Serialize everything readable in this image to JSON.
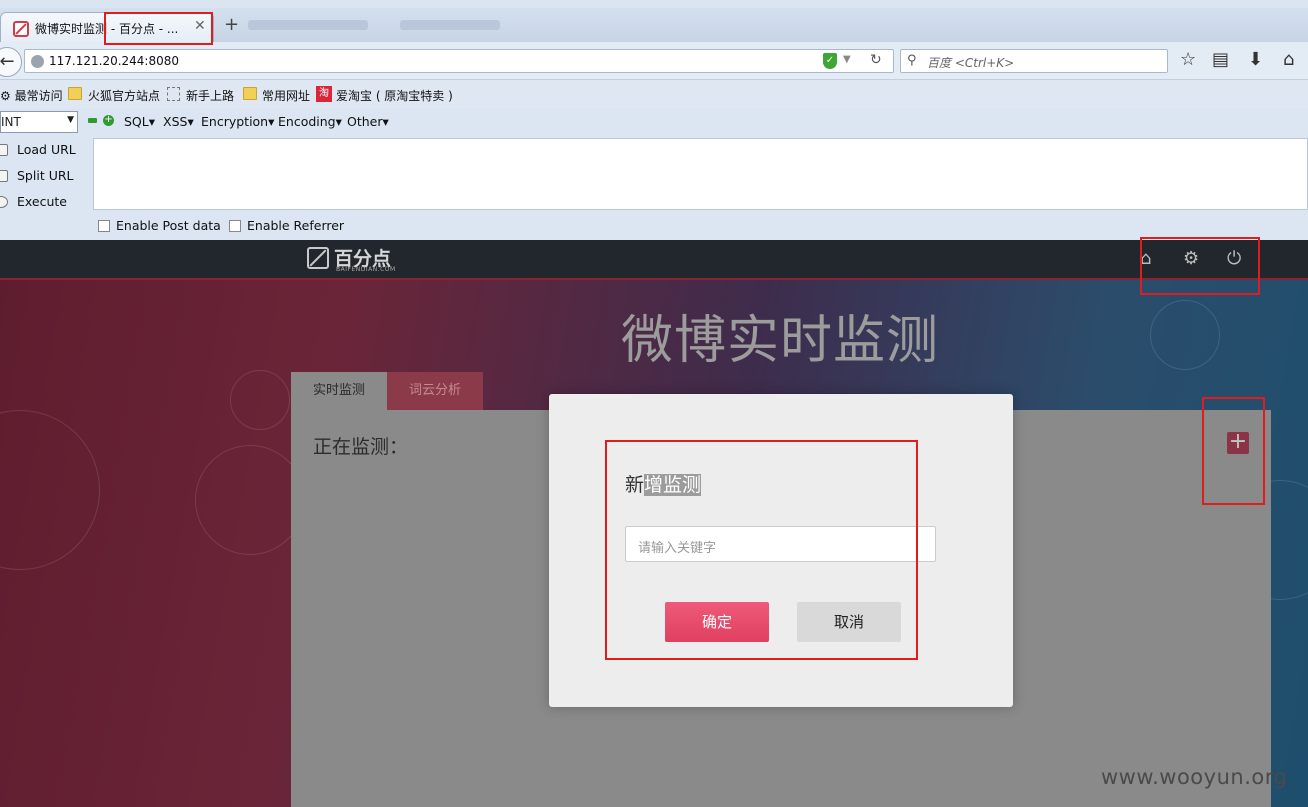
{
  "browser": {
    "tab_active_title": "微博实时监测 - 百分点 - ...",
    "url": "117.121.20.244:8080",
    "search_placeholder": "百度 <Ctrl+K>",
    "bookmarks": [
      {
        "label": "最常访问",
        "icon": "gear-icon"
      },
      {
        "label": "火狐官方站点",
        "icon": "folder-icon"
      },
      {
        "label": "新手上路",
        "icon": "page-icon"
      },
      {
        "label": "常用网址",
        "icon": "folder-icon"
      },
      {
        "label": "爱淘宝 ( 原淘宝特卖 )",
        "icon": "taobao-icon"
      }
    ]
  },
  "hackbar": {
    "select_value": "INT",
    "menus": [
      "SQL",
      "XSS",
      "Encryption",
      "Encoding",
      "Other"
    ],
    "actions": [
      "Load URL",
      "Split URL",
      "Execute"
    ],
    "checkbox_post": "Enable Post data",
    "checkbox_referrer": "Enable Referrer"
  },
  "site": {
    "logo_text": "百分点",
    "logo_sub": "BAIFENDIAN.COM",
    "title": "微博实时监测",
    "tabs": [
      "实时监测",
      "词云分析"
    ],
    "monitoring_label": "正在监测：",
    "add_symbol": "+",
    "header_icons": [
      "home-icon",
      "settings-icon",
      "power-icon"
    ]
  },
  "modal": {
    "title_prefix": "新",
    "title_selected": "增监测",
    "input_placeholder": "请输入关键字",
    "confirm_label": "确定",
    "cancel_label": "取消"
  },
  "watermark": "www.wooyun.org",
  "colors": {
    "annotation": "#e01d1d",
    "confirm_button": "#e84b6b",
    "header_bg": "#21272d"
  }
}
